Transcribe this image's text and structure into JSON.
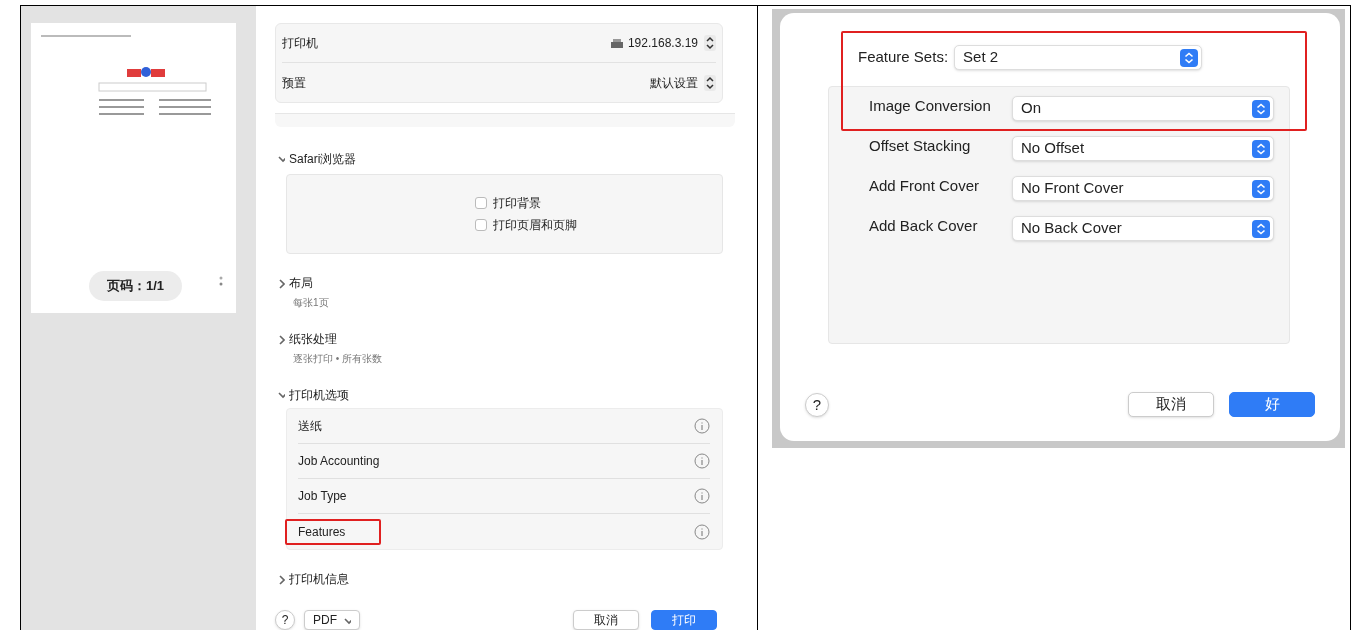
{
  "preview": {
    "page_counter": "页码：1/1"
  },
  "print_dialog": {
    "header_rows": [
      {
        "label": "打印机",
        "value": "192.168.3.19",
        "kind": "printer"
      },
      {
        "label": "预置",
        "value": "默认设置",
        "kind": "plain"
      }
    ],
    "sections": [
      {
        "title": "Safari浏览器",
        "expanded": true,
        "kind": "checkboxes",
        "options": [
          {
            "label": "打印背景",
            "checked": false
          },
          {
            "label": "打印页眉和页脚",
            "checked": false
          }
        ]
      },
      {
        "title": "布局",
        "expanded": false,
        "kind": "summary",
        "summary": "每张1页"
      },
      {
        "title": "纸张处理",
        "expanded": false,
        "kind": "summary",
        "summary": "逐张打印 • 所有张数"
      },
      {
        "title": "打印机选项",
        "expanded": true,
        "kind": "list",
        "items": [
          {
            "label": "送纸",
            "highlighted": false
          },
          {
            "label": "Job Accounting",
            "highlighted": false
          },
          {
            "label": "Job Type",
            "highlighted": false
          },
          {
            "label": "Features",
            "highlighted": true
          }
        ]
      },
      {
        "title": "打印机信息",
        "expanded": false,
        "kind": "summary"
      }
    ],
    "help": "?",
    "pdf": "PDF",
    "buttons": [
      {
        "label": "取消",
        "kind": "default"
      },
      {
        "label": "打印",
        "kind": "primary"
      }
    ]
  },
  "features_dialog": {
    "highlight": true,
    "feature_sets": {
      "label": "Feature Sets:",
      "value": "Set 2"
    },
    "options": [
      {
        "label": "Image Conversion",
        "value": "On"
      },
      {
        "label": "Offset Stacking",
        "value": "No Offset"
      },
      {
        "label": "Add Front Cover",
        "value": "No Front Cover"
      },
      {
        "label": "Add Back Cover",
        "value": "No Back Cover"
      }
    ],
    "help": "?",
    "buttons": [
      {
        "label": "取消",
        "kind": "default"
      },
      {
        "label": "好",
        "kind": "primary"
      }
    ]
  }
}
